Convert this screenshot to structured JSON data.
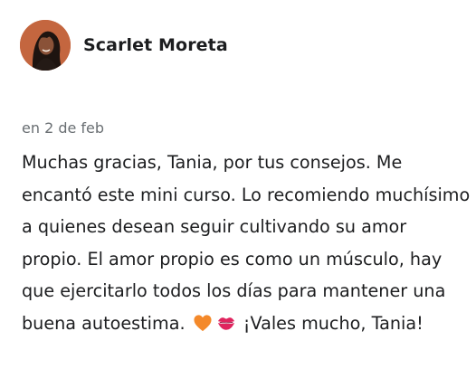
{
  "review": {
    "author": "Scarlet Moreta",
    "date": "en 2 de feb",
    "text_before_emoji": "Muchas gracias, Tania, por tus consejos. Me encantó este mini curso. Lo recomiendo muchísimo a quienes desean seguir cultivando su amor propio. El amor propio es como un músculo, hay que ejercitarlo todos los días para mantener una buena autoestima. ",
    "text_after_emoji": " ¡Vales mucho, Tania!",
    "emojis": [
      "orange-heart-icon",
      "kiss-mark-icon"
    ]
  },
  "colors": {
    "text": "#1c1d1f",
    "muted": "#6a6f73",
    "orange_heart": "#f4892a",
    "lips": "#e0245e"
  }
}
